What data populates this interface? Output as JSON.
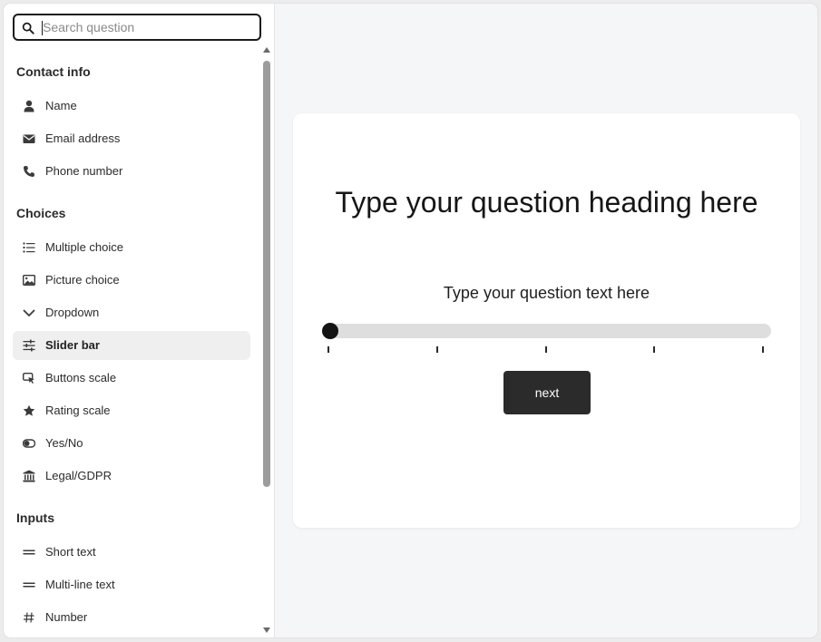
{
  "search": {
    "placeholder": "Search question"
  },
  "sections": {
    "contact": {
      "title": "Contact info",
      "items": [
        {
          "label": "Name",
          "icon": "person-icon"
        },
        {
          "label": "Email address",
          "icon": "envelope-icon"
        },
        {
          "label": "Phone number",
          "icon": "phone-icon"
        }
      ]
    },
    "choices": {
      "title": "Choices",
      "items": [
        {
          "label": "Multiple choice",
          "icon": "list-icon"
        },
        {
          "label": "Picture choice",
          "icon": "image-icon"
        },
        {
          "label": "Dropdown",
          "icon": "chevron-down-icon"
        },
        {
          "label": "Slider bar",
          "icon": "sliders-icon",
          "active": true
        },
        {
          "label": "Buttons scale",
          "icon": "cursor-click-icon"
        },
        {
          "label": "Rating scale",
          "icon": "star-icon"
        },
        {
          "label": "Yes/No",
          "icon": "toggle-icon"
        },
        {
          "label": "Legal/GDPR",
          "icon": "bank-icon"
        }
      ]
    },
    "inputs": {
      "title": "Inputs",
      "items": [
        {
          "label": "Short text",
          "icon": "short-text-icon"
        },
        {
          "label": "Multi-line text",
          "icon": "multiline-text-icon"
        },
        {
          "label": "Number",
          "icon": "hash-icon"
        }
      ]
    }
  },
  "question": {
    "heading": "Type your question heading here",
    "text": "Type your question text here",
    "slider_value": 0,
    "next_label": "next"
  },
  "colors": {
    "accent": "#2b2b2b",
    "active_item_bg": "#efefef",
    "canvas_bg": "#f5f6f8"
  }
}
